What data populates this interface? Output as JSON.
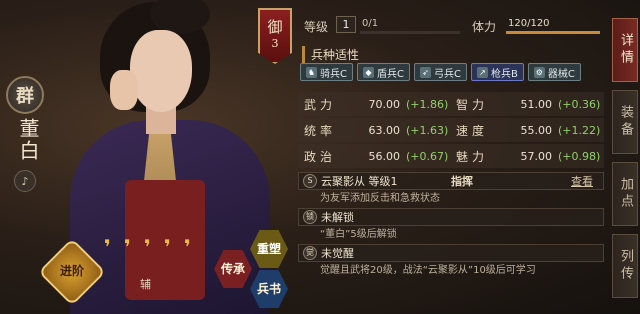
{
  "faction": "群",
  "name": "董白",
  "sound_icon": "speaker-icon",
  "rank": {
    "title": "御",
    "number": "3"
  },
  "level": {
    "label": "等级",
    "value": "1",
    "exp": "0/1"
  },
  "hp": {
    "label": "体力",
    "value": "120/120",
    "fraction": 1.0
  },
  "troops": {
    "title": "兵种适性",
    "items": [
      {
        "label": "骑兵C",
        "icon": "cavalry-icon",
        "highlight": false
      },
      {
        "label": "盾兵C",
        "icon": "shield-icon",
        "highlight": false
      },
      {
        "label": "弓兵C",
        "icon": "bow-icon",
        "highlight": false
      },
      {
        "label": "枪兵B",
        "icon": "spear-icon",
        "highlight": true
      },
      {
        "label": "器械C",
        "icon": "siege-icon",
        "highlight": false
      }
    ]
  },
  "stats": [
    {
      "label": "武力",
      "value": "70.00",
      "growth": "(+1.86)"
    },
    {
      "label": "智力",
      "value": "51.00",
      "growth": "(+0.36)"
    },
    {
      "label": "统率",
      "value": "63.00",
      "growth": "(+1.63)"
    },
    {
      "label": "速度",
      "value": "55.00",
      "growth": "(+1.22)"
    },
    {
      "label": "政治",
      "value": "56.00",
      "growth": "(+0.67)"
    },
    {
      "label": "魅力",
      "value": "57.00",
      "growth": "(+0.98)"
    }
  ],
  "skills": [
    {
      "icon": "S",
      "name": "云聚影从 等级1",
      "type": "指挥",
      "action": "查看",
      "desc": "为友军添加反击和急救状态"
    },
    {
      "icon": "锁",
      "name": "未解锁",
      "type": "",
      "action": "",
      "desc": "“董白”5级后解锁"
    },
    {
      "icon": "觉",
      "name": "未觉醒",
      "type": "",
      "action": "",
      "desc": "觉醒且武将20级，战法“云聚影从”10级后可学习"
    }
  ],
  "tabs": [
    {
      "label": "详情",
      "active": true
    },
    {
      "label": "装备",
      "active": false
    },
    {
      "label": "加点",
      "active": false
    },
    {
      "label": "列传",
      "active": false
    }
  ],
  "bottom": {
    "advance": "进阶",
    "aux": "辅",
    "inherit": "传承",
    "reshape": "重塑",
    "book": "兵书",
    "jade_count": "5"
  }
}
